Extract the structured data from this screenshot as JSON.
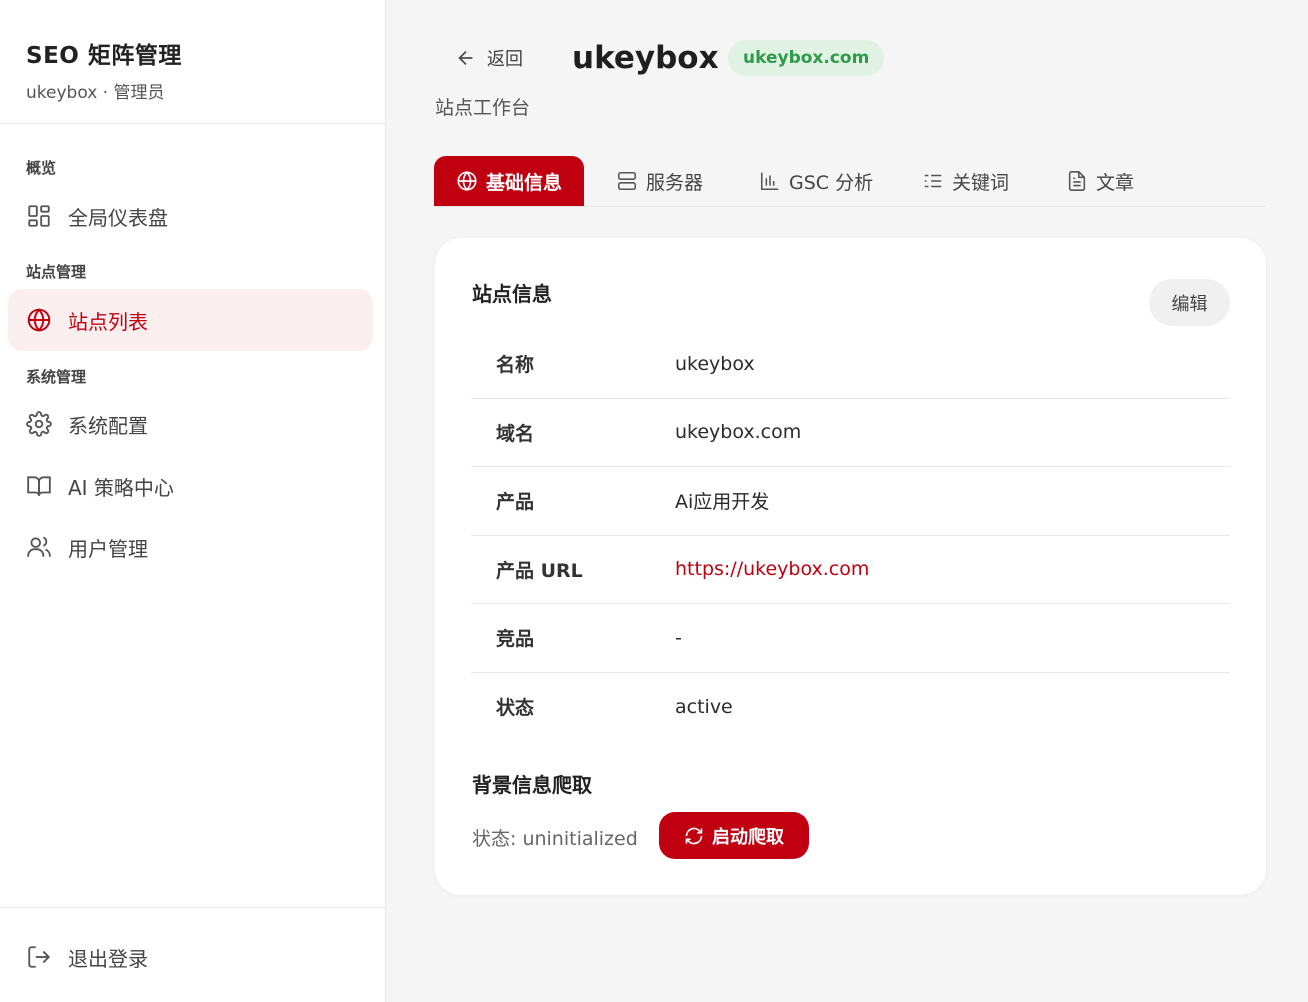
{
  "brand": {
    "title": "SEO 矩阵管理",
    "subtitle": "ukeybox · 管理员"
  },
  "sidebar": {
    "groups": [
      {
        "label": "概览"
      },
      {
        "label": "站点管理"
      },
      {
        "label": "系统管理"
      }
    ],
    "items": [
      {
        "label": "全局仪表盘",
        "icon": "dashboard-icon"
      },
      {
        "label": "站点列表",
        "icon": "globe-icon",
        "active": true
      },
      {
        "label": "系统配置",
        "icon": "gear-icon"
      },
      {
        "label": "AI 策略中心",
        "icon": "book-icon"
      },
      {
        "label": "用户管理",
        "icon": "users-icon"
      }
    ],
    "logout_label": "退出登录"
  },
  "header": {
    "back_label": "返回",
    "site_name": "ukeybox",
    "domain_badge": "ukeybox.com",
    "subtitle": "站点工作台"
  },
  "tabs": [
    {
      "label": "基础信息",
      "icon": "globe-icon",
      "active": true
    },
    {
      "label": "服务器",
      "icon": "server-icon"
    },
    {
      "label": "GSC 分析",
      "icon": "bar-chart-icon"
    },
    {
      "label": "关键词",
      "icon": "list-icon"
    },
    {
      "label": "文章",
      "icon": "file-text-icon"
    }
  ],
  "site_info": {
    "title": "站点信息",
    "edit_label": "编辑",
    "rows": [
      {
        "key": "名称",
        "value": "ukeybox"
      },
      {
        "key": "域名",
        "value": "ukeybox.com"
      },
      {
        "key": "产品",
        "value": "Ai应用开发"
      },
      {
        "key": "产品 URL",
        "value": "https://ukeybox.com"
      },
      {
        "key": "竞品",
        "value": "-"
      },
      {
        "key": "状态",
        "value": "active"
      }
    ]
  },
  "crawl": {
    "title": "背景信息爬取",
    "status": "状态: uninitialized",
    "button_label": "启动爬取"
  },
  "colors": {
    "accent": "#c00010",
    "badge_bg": "#dff2e3",
    "badge_text": "#2f9a48"
  }
}
